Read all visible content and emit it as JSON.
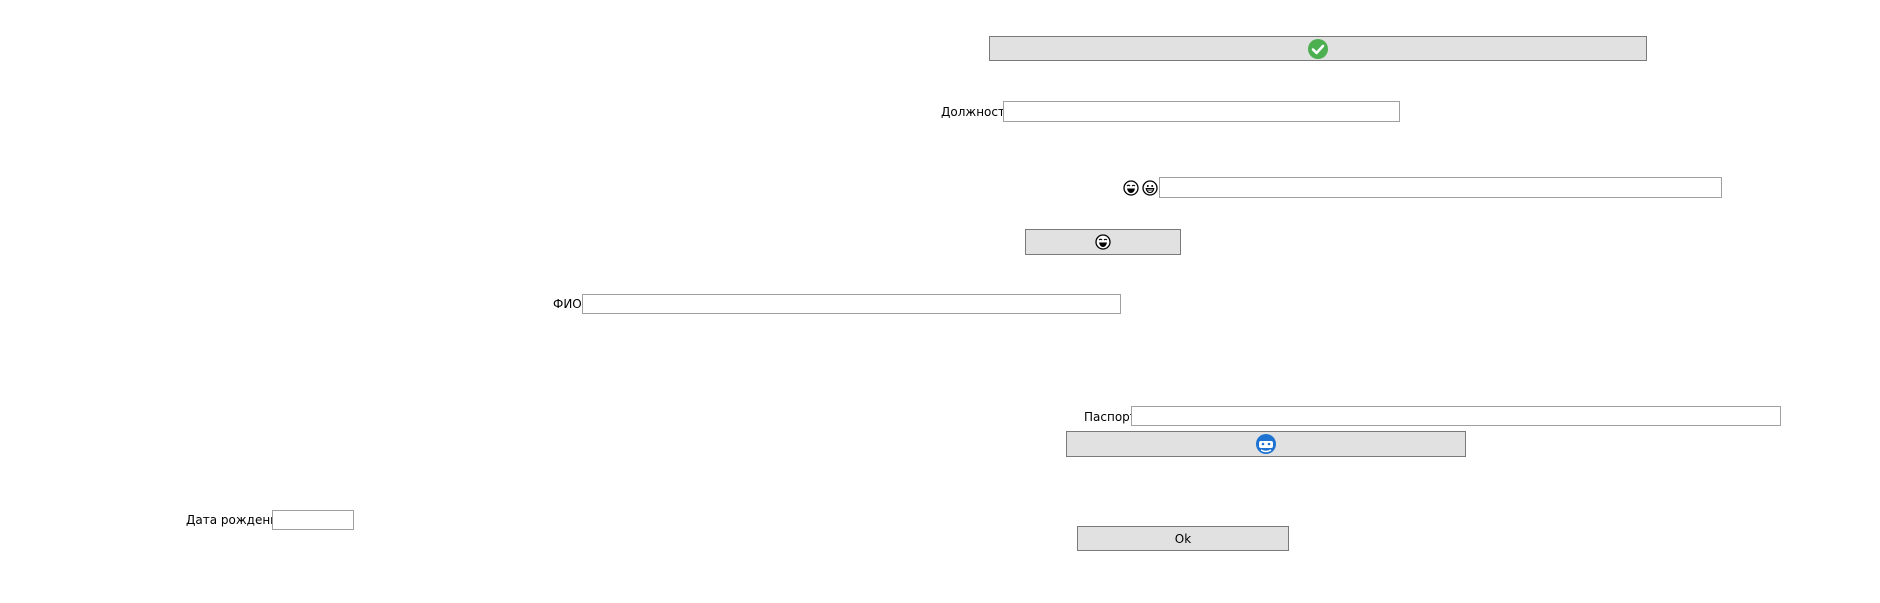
{
  "labels": {
    "position": "Должность",
    "fio": "ФИО",
    "passport": "Паспорт",
    "birth_date": "Дата рождения"
  },
  "buttons": {
    "ok": "Ok",
    "confirm_icon": "check-circle-icon",
    "laugh_icon": "laughing-face-icon",
    "smile_icon": "grinning-face-icon",
    "blue_icon": "blue-face-icon"
  },
  "fields": {
    "position_value": "",
    "emoji_value": "",
    "fio_value": "",
    "passport_value": "",
    "birth_date_value": ""
  },
  "colors": {
    "button_bg": "#e1e1e1",
    "button_border": "#7a7a7a",
    "field_border": "#a0a0a0",
    "check_green": "#4caf50",
    "icon_blue": "#1e73d2"
  }
}
